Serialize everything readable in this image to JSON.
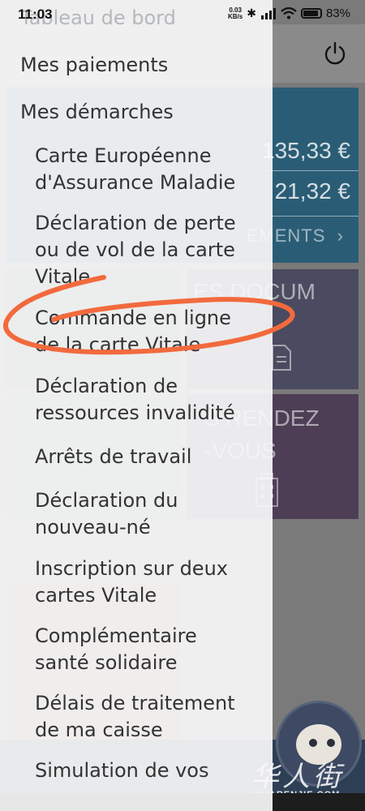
{
  "status_bar": {
    "time": "11:03",
    "net_speed_value": "0.03",
    "net_speed_unit": "KB/s",
    "battery": "83%"
  },
  "background": {
    "payments": {
      "amount_1": "135,33 €",
      "amount_2": "21,32 €",
      "all_link": "EMENTS"
    },
    "documents_tile": "ES DOCUM",
    "appointments_tile": [
      "S RENDEZ",
      "-VOUS"
    ]
  },
  "drawer": {
    "ghost_title": "Tableau de bord",
    "sections": [
      "Mes paiements",
      "Mes démarches"
    ],
    "items": [
      [
        "Carte Européenne",
        "d'Assurance Maladie"
      ],
      [
        "Déclaration de perte",
        "ou de vol de la carte",
        "Vitale"
      ],
      [
        "Commande en ligne",
        "de la carte Vitale"
      ],
      [
        "Déclaration de",
        "ressources invalidité"
      ],
      [
        "Arrêts de travail"
      ],
      [
        "Déclaration du",
        "nouveau-né"
      ],
      [
        "Inscription sur deux",
        "cartes Vitale"
      ],
      [
        "Complémentaire",
        "santé solidaire"
      ],
      [
        "Délais de traitement",
        "de ma caisse"
      ],
      [
        "Simulation de vos",
        ""
      ]
    ]
  },
  "watermark": {
    "cjk": "华人街",
    "text": "HUARENJIE.COM"
  },
  "colors": {
    "annotation": "#f26a3d",
    "payments_tile": "#2a5d75",
    "drawer_bg": "#f8f9fa"
  }
}
